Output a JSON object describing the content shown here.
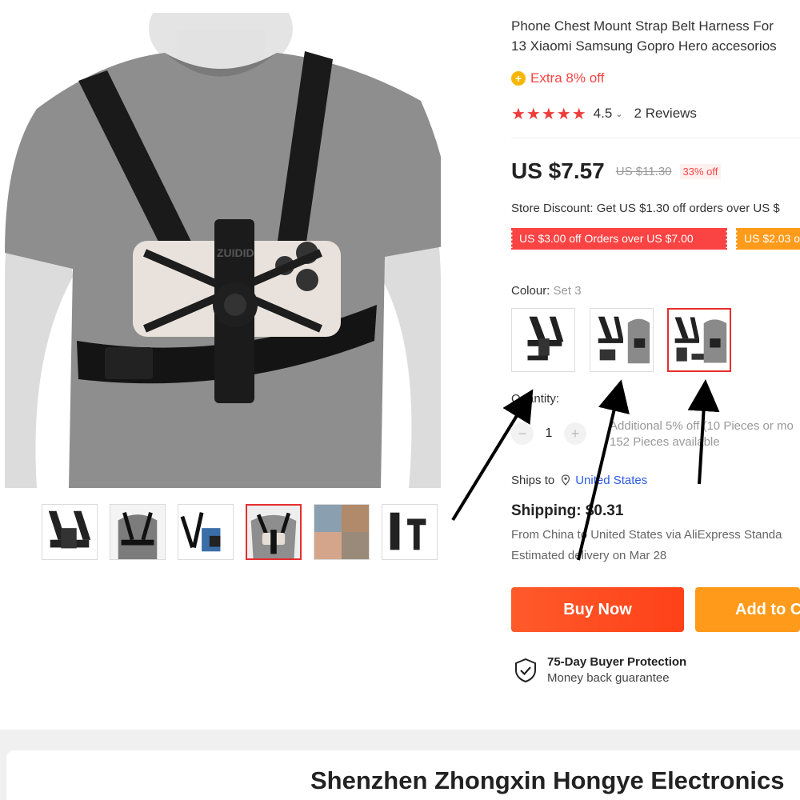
{
  "product": {
    "title_line1": "Phone Chest Mount Strap Belt Harness For",
    "title_line2": "13 Xiaomi Samsung Gopro Hero accesorios",
    "promo_icon": "+",
    "promo_text": "Extra 8% off",
    "rating_stars": "★★★★★",
    "rating_value": "4.5",
    "rating_caret": "⌄",
    "reviews": "2 Reviews",
    "price": "US $7.57",
    "old_price": "US $11.30",
    "discount": "33% off",
    "store_discount": "Store Discount: Get US $1.30 off orders over US $",
    "coupons": [
      "US $3.00 off Orders over US $7.00",
      "US $2.03 o"
    ],
    "colour_label": "Colour:",
    "colour_selected": "Set 3",
    "quantity_label": "Quantity:",
    "qty_minus": "−",
    "qty_plus": "+",
    "quantity_value": "1",
    "qty_note_line1": "Additional 5% off (10 Pieces or mo",
    "qty_note_line2": "152 Pieces available",
    "ships_to_label": "Ships to",
    "ships_to_country": "United States",
    "shipping": "Shipping: $0.31",
    "ship_from": "From China to United States via AliExpress Standa",
    "estimated_delivery": "Estimated delivery on Mar 28",
    "buy_now": "Buy Now",
    "add_to_cart": "Add to C",
    "protection_title": "75-Day Buyer Protection",
    "protection_sub": "Money back guarantee"
  },
  "gallery": {
    "active_thumbnail": 4,
    "image_brand_text": "ZUIDID"
  },
  "store": {
    "name": "Shenzhen Zhongxin Hongye Electronics"
  },
  "colors": {
    "accent_red": "#fa4343",
    "buy_orange": "#ff4f1f",
    "cart_orange": "#ff9a1a",
    "link_blue": "#2e5ae6",
    "star_red": "#ee3b3b"
  }
}
